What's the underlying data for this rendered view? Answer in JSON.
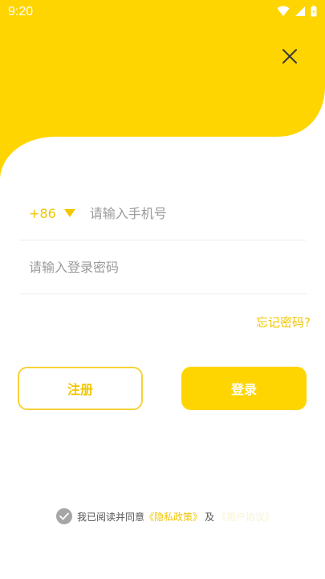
{
  "status_bar": {
    "time": "9:20"
  },
  "login": {
    "country_code": "+86",
    "phone_placeholder": "请输入手机号",
    "password_placeholder": "请输入登录密码",
    "forgot_password": "忘记密码?",
    "register_button": "注册",
    "login_button": "登录"
  },
  "agreement": {
    "prefix": "我已阅读并同意",
    "privacy_link": "《隐私政策》",
    "and": "及",
    "user_link": "《用户协议》"
  },
  "colors": {
    "brand_yellow": "#fed500",
    "accent_text": "#f2c600"
  },
  "icons": [
    "wifi-icon",
    "signal-icon",
    "battery-icon",
    "close-icon",
    "dropdown-triangle-icon",
    "check-icon"
  ]
}
